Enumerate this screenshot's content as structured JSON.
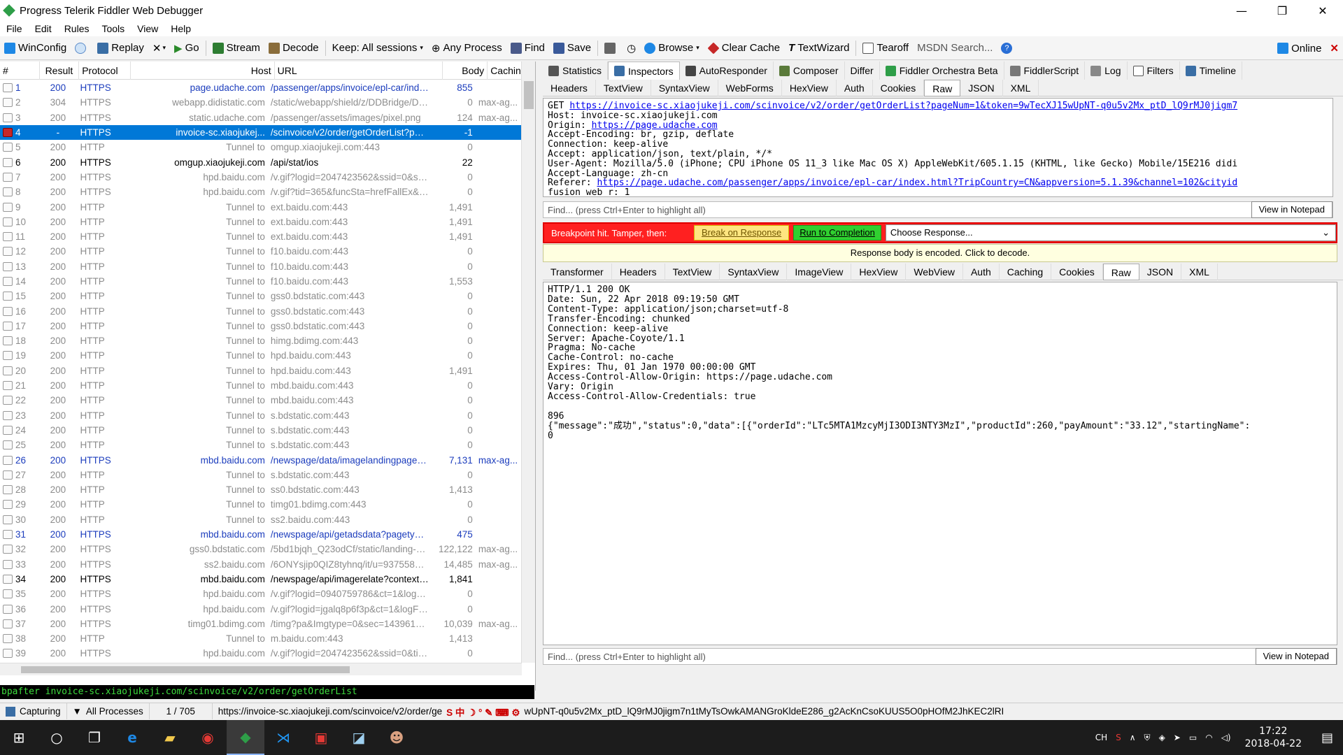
{
  "window": {
    "title": "Progress Telerik Fiddler Web Debugger"
  },
  "menu": [
    "File",
    "Edit",
    "Rules",
    "Tools",
    "View",
    "Help"
  ],
  "toolbar": {
    "winconfig": "WinConfig",
    "replay": "Replay",
    "remove": "✕",
    "go": "Go",
    "stream": "Stream",
    "decode": "Decode",
    "keep": "Keep: All sessions",
    "any_process": "Any Process",
    "find": "Find",
    "save": "Save",
    "browse": "Browse",
    "clear_cache": "Clear Cache",
    "textwizard": "TextWizard",
    "tearoff": "Tearoff",
    "msdn_search": "MSDN Search...",
    "online": "Online"
  },
  "sessions": {
    "columns": [
      "#",
      "Result",
      "Protocol",
      "Host",
      "URL",
      "Body",
      "Caching"
    ],
    "rows": [
      {
        "id": "1",
        "result": "200",
        "protocol": "HTTPS",
        "host": "page.udache.com",
        "url": "/passenger/apps/invoice/epl-car/index...",
        "body": "855",
        "caching": "",
        "style": "blue"
      },
      {
        "id": "2",
        "result": "304",
        "protocol": "HTTPS",
        "host": "webapp.didistatic.com",
        "url": "/static/webapp/shield/z/DDBridge/DDB...",
        "body": "0",
        "caching": "max-ag...",
        "style": "tunnel"
      },
      {
        "id": "3",
        "result": "200",
        "protocol": "HTTPS",
        "host": "static.udache.com",
        "url": "/passenger/assets/images/pixel.png",
        "body": "124",
        "caching": "max-ag...",
        "style": "tunnel"
      },
      {
        "id": "4",
        "result": "-",
        "protocol": "HTTPS",
        "host": "invoice-sc.xiaojukej...",
        "url": "/scinvoice/v2/order/getOrderList?page...",
        "body": "-1",
        "caching": "",
        "style": "sel"
      },
      {
        "id": "5",
        "result": "200",
        "protocol": "HTTP",
        "host": "Tunnel to",
        "url": "omgup.xiaojukeji.com:443",
        "body": "0",
        "caching": "",
        "style": "tunnel"
      },
      {
        "id": "6",
        "result": "200",
        "protocol": "HTTPS",
        "host": "omgup.xiaojukeji.com",
        "url": "/api/stat/ios",
        "body": "22",
        "caching": "",
        "style": "https"
      },
      {
        "id": "7",
        "result": "200",
        "protocol": "HTTPS",
        "host": "hpd.baidu.com",
        "url": "/v.gif?logid=2047423562&ssid=0&sid...",
        "body": "0",
        "caching": "",
        "style": "tunnel"
      },
      {
        "id": "8",
        "result": "200",
        "protocol": "HTTPS",
        "host": "hpd.baidu.com",
        "url": "/v.gif?tid=365&funcSta=hrefFallEx&s...",
        "body": "0",
        "caching": "",
        "style": "tunnel"
      },
      {
        "id": "9",
        "result": "200",
        "protocol": "HTTP",
        "host": "Tunnel to",
        "url": "ext.baidu.com:443",
        "body": "1,491",
        "caching": "",
        "style": "tunnel"
      },
      {
        "id": "10",
        "result": "200",
        "protocol": "HTTP",
        "host": "Tunnel to",
        "url": "ext.baidu.com:443",
        "body": "1,491",
        "caching": "",
        "style": "tunnel"
      },
      {
        "id": "11",
        "result": "200",
        "protocol": "HTTP",
        "host": "Tunnel to",
        "url": "ext.baidu.com:443",
        "body": "1,491",
        "caching": "",
        "style": "tunnel"
      },
      {
        "id": "12",
        "result": "200",
        "protocol": "HTTP",
        "host": "Tunnel to",
        "url": "f10.baidu.com:443",
        "body": "0",
        "caching": "",
        "style": "tunnel"
      },
      {
        "id": "13",
        "result": "200",
        "protocol": "HTTP",
        "host": "Tunnel to",
        "url": "f10.baidu.com:443",
        "body": "0",
        "caching": "",
        "style": "tunnel"
      },
      {
        "id": "14",
        "result": "200",
        "protocol": "HTTP",
        "host": "Tunnel to",
        "url": "f10.baidu.com:443",
        "body": "1,553",
        "caching": "",
        "style": "tunnel"
      },
      {
        "id": "15",
        "result": "200",
        "protocol": "HTTP",
        "host": "Tunnel to",
        "url": "gss0.bdstatic.com:443",
        "body": "0",
        "caching": "",
        "style": "tunnel"
      },
      {
        "id": "16",
        "result": "200",
        "protocol": "HTTP",
        "host": "Tunnel to",
        "url": "gss0.bdstatic.com:443",
        "body": "0",
        "caching": "",
        "style": "tunnel"
      },
      {
        "id": "17",
        "result": "200",
        "protocol": "HTTP",
        "host": "Tunnel to",
        "url": "gss0.bdstatic.com:443",
        "body": "0",
        "caching": "",
        "style": "tunnel"
      },
      {
        "id": "18",
        "result": "200",
        "protocol": "HTTP",
        "host": "Tunnel to",
        "url": "himg.bdimg.com:443",
        "body": "0",
        "caching": "",
        "style": "tunnel"
      },
      {
        "id": "19",
        "result": "200",
        "protocol": "HTTP",
        "host": "Tunnel to",
        "url": "hpd.baidu.com:443",
        "body": "0",
        "caching": "",
        "style": "tunnel"
      },
      {
        "id": "20",
        "result": "200",
        "protocol": "HTTP",
        "host": "Tunnel to",
        "url": "hpd.baidu.com:443",
        "body": "1,491",
        "caching": "",
        "style": "tunnel"
      },
      {
        "id": "21",
        "result": "200",
        "protocol": "HTTP",
        "host": "Tunnel to",
        "url": "mbd.baidu.com:443",
        "body": "0",
        "caching": "",
        "style": "tunnel"
      },
      {
        "id": "22",
        "result": "200",
        "protocol": "HTTP",
        "host": "Tunnel to",
        "url": "mbd.baidu.com:443",
        "body": "0",
        "caching": "",
        "style": "tunnel"
      },
      {
        "id": "23",
        "result": "200",
        "protocol": "HTTP",
        "host": "Tunnel to",
        "url": "s.bdstatic.com:443",
        "body": "0",
        "caching": "",
        "style": "tunnel"
      },
      {
        "id": "24",
        "result": "200",
        "protocol": "HTTP",
        "host": "Tunnel to",
        "url": "s.bdstatic.com:443",
        "body": "0",
        "caching": "",
        "style": "tunnel"
      },
      {
        "id": "25",
        "result": "200",
        "protocol": "HTTP",
        "host": "Tunnel to",
        "url": "s.bdstatic.com:443",
        "body": "0",
        "caching": "",
        "style": "tunnel"
      },
      {
        "id": "26",
        "result": "200",
        "protocol": "HTTPS",
        "host": "mbd.baidu.com",
        "url": "/newspage/data/imagelandingpage?s_...",
        "body": "7,131",
        "caching": "max-ag...",
        "style": "blue"
      },
      {
        "id": "27",
        "result": "200",
        "protocol": "HTTP",
        "host": "Tunnel to",
        "url": "s.bdstatic.com:443",
        "body": "0",
        "caching": "",
        "style": "tunnel"
      },
      {
        "id": "28",
        "result": "200",
        "protocol": "HTTP",
        "host": "Tunnel to",
        "url": "ss0.bdstatic.com:443",
        "body": "1,413",
        "caching": "",
        "style": "tunnel"
      },
      {
        "id": "29",
        "result": "200",
        "protocol": "HTTP",
        "host": "Tunnel to",
        "url": "timg01.bdimg.com:443",
        "body": "0",
        "caching": "",
        "style": "tunnel"
      },
      {
        "id": "30",
        "result": "200",
        "protocol": "HTTP",
        "host": "Tunnel to",
        "url": "ss2.baidu.com:443",
        "body": "0",
        "caching": "",
        "style": "tunnel"
      },
      {
        "id": "31",
        "result": "200",
        "protocol": "HTTPS",
        "host": "mbd.baidu.com",
        "url": "/newspage/api/getadsdata?pagetype...",
        "body": "475",
        "caching": "",
        "style": "blue"
      },
      {
        "id": "32",
        "result": "200",
        "protocol": "HTTPS",
        "host": "gss0.bdstatic.com",
        "url": "/5bd1bjqh_Q23odCf/static/landing-alb...",
        "body": "122,122",
        "caching": "max-ag...",
        "style": "tunnel"
      },
      {
        "id": "33",
        "result": "200",
        "protocol": "HTTPS",
        "host": "ss2.baidu.com",
        "url": "/6ONYsjip0QIZ8tyhnq/it/u=93755855...",
        "body": "14,485",
        "caching": "max-ag...",
        "style": "tunnel"
      },
      {
        "id": "34",
        "result": "200",
        "protocol": "HTTPS",
        "host": "mbd.baidu.com",
        "url": "/newspage/api/imagerelate?context=...",
        "body": "1,841",
        "caching": "",
        "style": "https"
      },
      {
        "id": "35",
        "result": "200",
        "protocol": "HTTPS",
        "host": "hpd.baidu.com",
        "url": "/v.gif?logid=0940759786&ct=1&logFr...",
        "body": "0",
        "caching": "",
        "style": "tunnel"
      },
      {
        "id": "36",
        "result": "200",
        "protocol": "HTTPS",
        "host": "hpd.baidu.com",
        "url": "/v.gif?logid=jgalq8p6f3p&ct=1&logFro...",
        "body": "0",
        "caching": "",
        "style": "tunnel"
      },
      {
        "id": "37",
        "result": "200",
        "protocol": "HTTPS",
        "host": "timg01.bdimg.com",
        "url": "/timg?pa&Imgtype=0&sec=14396196...",
        "body": "10,039",
        "caching": "max-ag...",
        "style": "tunnel"
      },
      {
        "id": "38",
        "result": "200",
        "protocol": "HTTP",
        "host": "Tunnel to",
        "url": "m.baidu.com:443",
        "body": "1,413",
        "caching": "",
        "style": "tunnel"
      },
      {
        "id": "39",
        "result": "200",
        "protocol": "HTTPS",
        "host": "hpd.baidu.com",
        "url": "/v.gif?logid=2047423562&ssid=0&tid...",
        "body": "0",
        "caching": "",
        "style": "tunnel"
      }
    ]
  },
  "quickexec": "bpafter invoice-sc.xiaojukeji.com/scinvoice/v2/order/getOrderList",
  "inspectors": {
    "main_tabs": [
      {
        "label": "Statistics",
        "color": "#555555"
      },
      {
        "label": "Inspectors",
        "color": "#3a6ea5"
      },
      {
        "label": "AutoResponder",
        "color": "#444444"
      },
      {
        "label": "Composer",
        "color": "#5a7a3a"
      },
      {
        "label": "Differ",
        "color": ""
      },
      {
        "label": "Fiddler Orchestra Beta",
        "color": "#2e9e48"
      },
      {
        "label": "FiddlerScript",
        "color": "#777777"
      },
      {
        "label": "Log",
        "color": "#888888"
      },
      {
        "label": "Filters",
        "color": "#ffffff"
      },
      {
        "label": "Timeline",
        "color": "#3a6ea5"
      }
    ],
    "request_tabs": [
      "Headers",
      "TextView",
      "SyntaxView",
      "WebForms",
      "HexView",
      "Auth",
      "Cookies",
      "Raw",
      "JSON",
      "XML"
    ],
    "request_raw": {
      "l1_pre": "GET ",
      "l1_link": "https://invoice-sc.xiaojukeji.com/scinvoice/v2/order/getOrderList?pageNum=1&token=9wTecXJ15wUpNT-q0u5v2Mx_ptD_lQ9rMJ0jigm7",
      "l2": "Host: invoice-sc.xiaojukeji.com",
      "l3_pre": "Origin: ",
      "l3_link": "https://page.udache.com",
      "l4": "Accept-Encoding: br, gzip, deflate",
      "l5": "Connection: keep-alive",
      "l6": "Accept: application/json, text/plain, */*",
      "l7": "User-Agent: Mozilla/5.0 (iPhone; CPU iPhone OS 11_3 like Mac OS X) AppleWebKit/605.1.15 (KHTML, like Gecko) Mobile/15E216 didi",
      "l8": "Accept-Language: zh-cn",
      "l9_pre": "Referer: ",
      "l9_link": "https://page.udache.com/passenger/apps/invoice/epl-car/index.html?TripCountry=CN&appversion=5.1.39&channel=102&cityid",
      "l10": "fusion web r: 1"
    },
    "find_placeholder": "Find... (press Ctrl+Enter to highlight all)",
    "view_in_notepad": "View in Notepad",
    "breakpoint": {
      "text": "Breakpoint hit. Tamper, then:",
      "break_on_response": "Break on Response",
      "run_to_completion": "Run to Completion",
      "choose_response": "Choose Response..."
    },
    "encoded_notice": "Response body is encoded. Click to decode.",
    "response_tabs": [
      "Transformer",
      "Headers",
      "TextView",
      "SyntaxView",
      "ImageView",
      "HexView",
      "WebView",
      "Auth",
      "Caching",
      "Cookies",
      "Raw",
      "JSON",
      "XML"
    ],
    "response_raw": [
      "HTTP/1.1 200 OK",
      "Date: Sun, 22 Apr 2018 09:19:50 GMT",
      "Content-Type: application/json;charset=utf-8",
      "Transfer-Encoding: chunked",
      "Connection: keep-alive",
      "Server: Apache-Coyote/1.1",
      "Pragma: No-cache",
      "Cache-Control: no-cache",
      "Expires: Thu, 01 Jan 1970 00:00:00 GMT",
      "Access-Control-Allow-Origin: https://page.udache.com",
      "Vary: Origin",
      "Access-Control-Allow-Credentials: true",
      "",
      "896",
      "{\"message\":\"成功\",\"status\":0,\"data\":[{\"orderId\":\"LTc5MTA1MzcyMjI3ODI3NTY3MzI\",\"productId\":260,\"payAmount\":\"33.12\",\"startingName\":",
      "0"
    ]
  },
  "statusbar": {
    "capturing": "Capturing",
    "processes": "All Processes",
    "count": "1 / 705",
    "url": "https://invoice-sc.xiaojukeji.com/scinvoice/v2/order/ge",
    "url_tail": "wUpNT-q0u5v2Mx_ptD_lQ9rMJ0jigm7n1tMyTsOwkAMANGroKldeE286_g2AcKnCsoKUUS5O0pHOfM2JhKEC2lRI"
  },
  "taskbar": {
    "ime": "CH",
    "time": "17:22",
    "date": "2018-04-22"
  }
}
